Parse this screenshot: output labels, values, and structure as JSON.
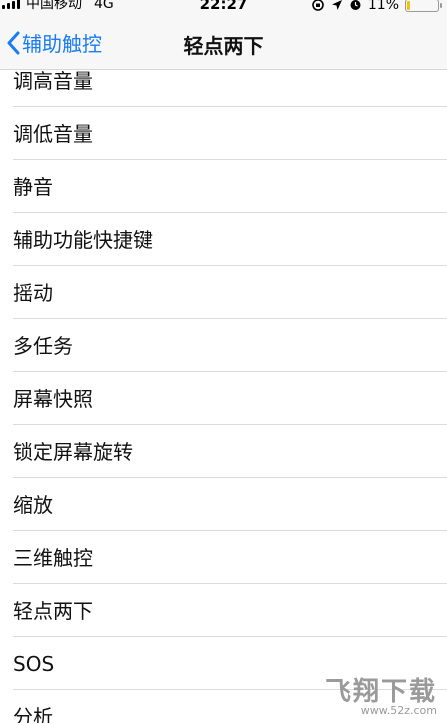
{
  "status_bar": {
    "carrier": "中国移动",
    "network": "4G",
    "time": "22:27",
    "battery": "11%",
    "battery_level": 0.11,
    "battery_color": "#f5c400"
  },
  "nav": {
    "back_label": "辅助触控",
    "title": "轻点两下",
    "accent_color": "#1a7cf5"
  },
  "items": [
    {
      "label": "调高音量"
    },
    {
      "label": "调低音量"
    },
    {
      "label": "静音"
    },
    {
      "label": "辅助功能快捷键"
    },
    {
      "label": "摇动"
    },
    {
      "label": "多任务"
    },
    {
      "label": "屏幕快照"
    },
    {
      "label": "锁定屏幕旋转"
    },
    {
      "label": "缩放"
    },
    {
      "label": "三维触控"
    },
    {
      "label": "轻点两下"
    },
    {
      "label": "SOS"
    },
    {
      "label": "分析"
    }
  ],
  "watermark": {
    "logo": "飞翔下载",
    "url": "www.52z.com"
  }
}
